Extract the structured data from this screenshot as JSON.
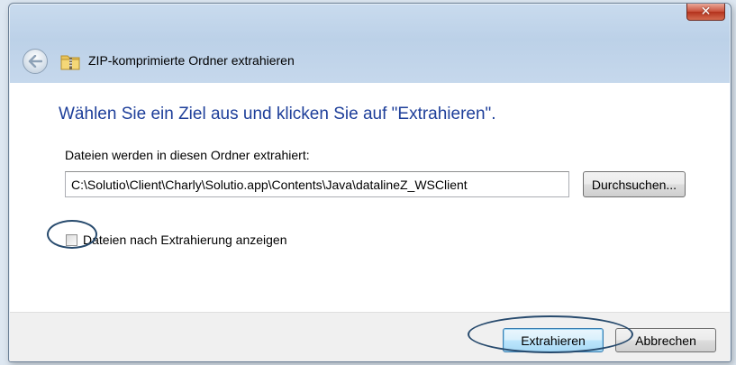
{
  "window": {
    "title": "ZIP-komprimierte Ordner extrahieren",
    "close_glyph": "✕"
  },
  "dialog": {
    "instruction": "Wählen Sie ein Ziel aus und klicken Sie auf \"Extrahieren\".",
    "path_label": "Dateien werden in diesen Ordner extrahiert:",
    "path_value": "C:\\Solutio\\Client\\Charly\\Solutio.app\\Contents\\Java\\datalineZ_WSClient",
    "browse_label": "Durchsuchen...",
    "show_files_label": "Dateien nach Extrahierung anzeigen",
    "show_files_checked": false
  },
  "footer": {
    "extract_label": "Extrahieren",
    "cancel_label": "Abbrechen"
  },
  "colors": {
    "instruction_text": "#1e3f9a",
    "annotation_outline": "#274a6d",
    "close_button": "#c9503a"
  },
  "icons": {
    "back": "back-arrow-icon",
    "folder": "zip-folder-icon",
    "close": "close-icon"
  }
}
